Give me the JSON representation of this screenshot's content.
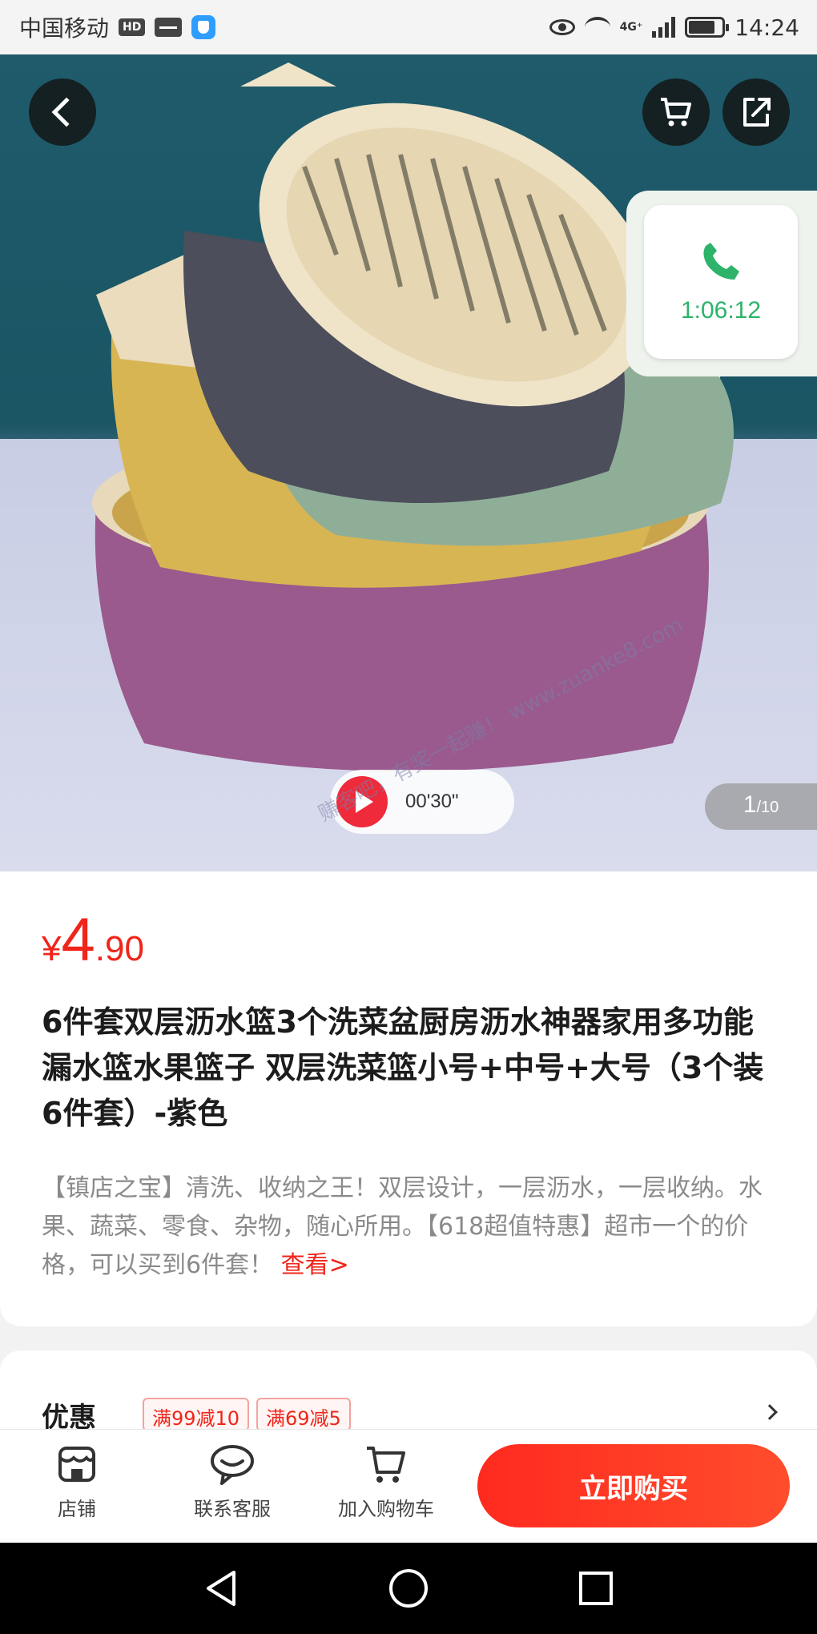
{
  "status_bar": {
    "carrier": "中国移动",
    "hd_badge": "HD",
    "network": "4G⁺",
    "time": "14:24",
    "icons": [
      "hd-icon",
      "activity-icon",
      "shield-app-icon",
      "eye-icon",
      "wifi-icon",
      "signal-icon",
      "battery-icon"
    ]
  },
  "hero": {
    "icons": [
      "back-icon",
      "cart-icon",
      "share-icon",
      "phone-icon",
      "play-icon"
    ],
    "call_time": "1:06:12",
    "video_duration": "00'30\"",
    "page_current": "1",
    "page_total": "/10",
    "watermark": "赚客吧，有奖一起赚！ www.zuanke8.com"
  },
  "product": {
    "price_symbol": "¥",
    "price_int": "4",
    "price_dec": ".90",
    "title": "6件套双层沥水篮3个洗菜盆厨房沥水神器家用多功能漏水篮水果篮子 双层洗菜篮小号+中号+大号（3个装6件套）-紫色",
    "description": "【镇店之宝】清洗、收纳之王！双层设计，一层沥水，一层收纳。水果、蔬菜、零食、杂物，随心所用。【618超值特惠】超市一个的价格，可以买到6件套！",
    "more_link": "查看>"
  },
  "promo": {
    "label": "优惠",
    "coupons": [
      "满99减10",
      "满69减5"
    ]
  },
  "bottom_bar": {
    "shop_label": "店铺",
    "service_label": "联系客服",
    "add_cart_label": "加入购物车",
    "buy_label": "立即购买"
  },
  "colors": {
    "accent_red": "#f0251a",
    "call_green": "#2db36a"
  }
}
